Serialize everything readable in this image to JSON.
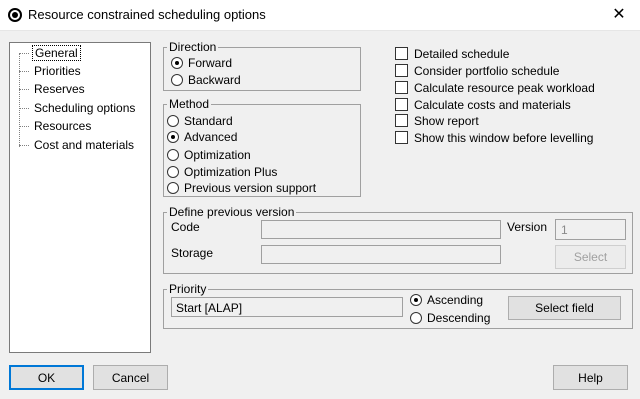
{
  "window": {
    "title": "Resource constrained scheduling options",
    "close_glyph": "✕"
  },
  "tree": {
    "items": [
      {
        "label": "General",
        "selected": true
      },
      {
        "label": "Priorities"
      },
      {
        "label": "Reserves"
      },
      {
        "label": "Scheduling options"
      },
      {
        "label": "Resources"
      },
      {
        "label": "Cost and materials"
      }
    ]
  },
  "direction": {
    "title": "Direction",
    "options": [
      {
        "label": "Forward",
        "selected": true
      },
      {
        "label": "Backward",
        "selected": false
      }
    ]
  },
  "method": {
    "title": "Method",
    "options": [
      {
        "label": "Standard",
        "selected": false
      },
      {
        "label": "Advanced",
        "selected": true
      },
      {
        "label": "Optimization",
        "selected": false
      },
      {
        "label": "Optimization Plus",
        "selected": false
      },
      {
        "label": "Previous version support",
        "selected": false
      }
    ]
  },
  "checkboxes": [
    {
      "label": "Detailed schedule",
      "checked": false
    },
    {
      "label": "Consider portfolio schedule",
      "checked": false
    },
    {
      "label": "Calculate resource peak workload",
      "checked": false
    },
    {
      "label": "Calculate costs and materials",
      "checked": false
    },
    {
      "label": "Show report",
      "checked": false
    },
    {
      "label": "Show this window before levelling",
      "checked": false
    }
  ],
  "previous_version": {
    "title": "Define previous version",
    "code_label": "Code",
    "code_value": "",
    "version_label": "Version",
    "version_value": "1",
    "storage_label": "Storage",
    "storage_value": "",
    "select_button": "Select"
  },
  "priority": {
    "title": "Priority",
    "value": "Start [ALAP]",
    "ascending_label": "Ascending",
    "descending_label": "Descending",
    "ascending_selected": true,
    "select_field_button": "Select field"
  },
  "buttons": {
    "ok": "OK",
    "cancel": "Cancel",
    "help": "Help"
  }
}
